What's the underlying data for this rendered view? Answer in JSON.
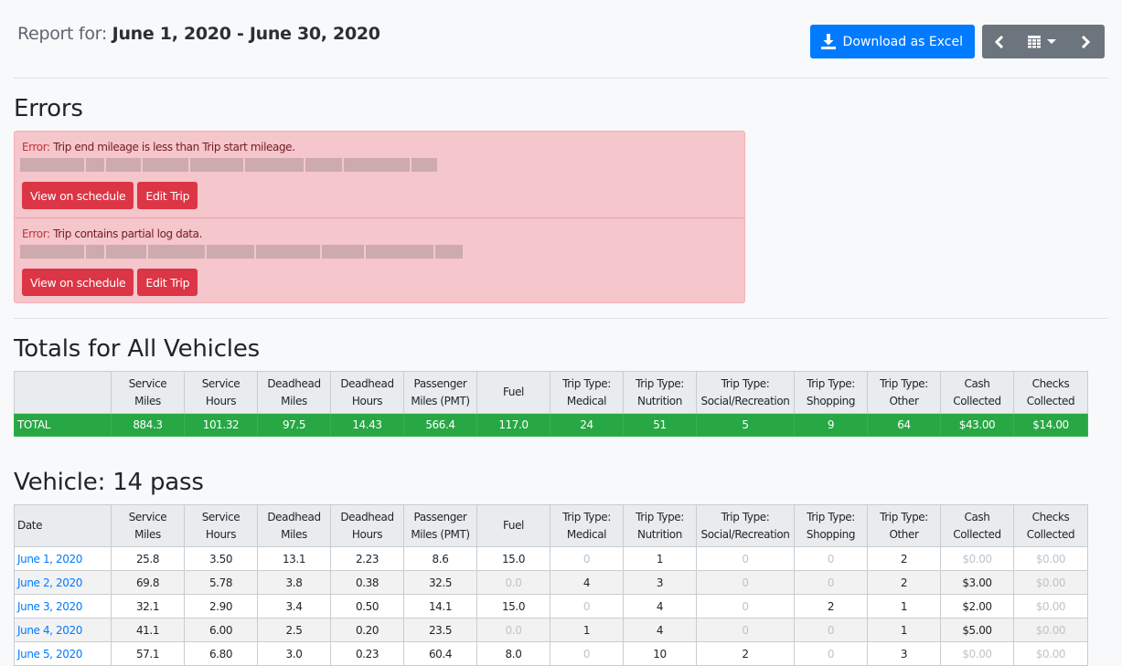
{
  "header": {
    "label": "Report for:",
    "range": "June 1, 2020 - June 30, 2020"
  },
  "actions": {
    "download_label": "Download as Excel",
    "download_icon": "download-icon",
    "prev_icon": "caret-left-icon",
    "calendar_icon": "calendar-icon",
    "next_icon": "caret-right-icon"
  },
  "errors": {
    "title": "Errors",
    "items": [
      {
        "label": "Error:",
        "message": "Trip end mileage is less than Trip start mileage.",
        "view": "View on schedule",
        "edit": "Edit Trip"
      },
      {
        "label": "Error:",
        "message": "Trip contains partial log data.",
        "view": "View on schedule",
        "edit": "Edit Trip"
      }
    ]
  },
  "columns": [
    {
      "l1": "Service",
      "l2": "Miles"
    },
    {
      "l1": "Service",
      "l2": "Hours"
    },
    {
      "l1": "Deadhead",
      "l2": "Miles"
    },
    {
      "l1": "Deadhead",
      "l2": "Hours"
    },
    {
      "l1": "Passenger",
      "l2": "Miles (PMT)"
    },
    {
      "l1": "Fuel",
      "l2": ""
    },
    {
      "l1": "Trip Type:",
      "l2": "Medical"
    },
    {
      "l1": "Trip Type:",
      "l2": "Nutrition"
    },
    {
      "l1": "Trip Type:",
      "l2": "Social/Recreation"
    },
    {
      "l1": "Trip Type:",
      "l2": "Shopping"
    },
    {
      "l1": "Trip Type:",
      "l2": "Other"
    },
    {
      "l1": "Cash",
      "l2": "Collected"
    },
    {
      "l1": "Checks",
      "l2": "Collected"
    }
  ],
  "totals": {
    "title": "Totals for All Vehicles",
    "row_label": "TOTAL",
    "values": [
      "884.3",
      "101.32",
      "97.5",
      "14.43",
      "566.4",
      "117.0",
      "24",
      "51",
      "5",
      "9",
      "64",
      "$43.00",
      "$14.00"
    ]
  },
  "vehicle": {
    "title": "Vehicle: 14 pass",
    "date_header": "Date",
    "rows": [
      {
        "date": "June 1, 2020",
        "values": [
          "25.8",
          "3.50",
          "13.1",
          "2.23",
          "8.6",
          "15.0",
          "0",
          "1",
          "0",
          "0",
          "2",
          "$0.00",
          "$0.00"
        ]
      },
      {
        "date": "June 2, 2020",
        "values": [
          "69.8",
          "5.78",
          "3.8",
          "0.38",
          "32.5",
          "0.0",
          "4",
          "3",
          "0",
          "0",
          "2",
          "$3.00",
          "$0.00"
        ]
      },
      {
        "date": "June 3, 2020",
        "values": [
          "32.1",
          "2.90",
          "3.4",
          "0.50",
          "14.1",
          "15.0",
          "0",
          "4",
          "0",
          "2",
          "1",
          "$2.00",
          "$0.00"
        ]
      },
      {
        "date": "June 4, 2020",
        "values": [
          "41.1",
          "6.00",
          "2.5",
          "0.20",
          "23.5",
          "0.0",
          "1",
          "4",
          "0",
          "0",
          "1",
          "$5.00",
          "$0.00"
        ]
      },
      {
        "date": "June 5, 2020",
        "values": [
          "57.1",
          "6.80",
          "3.0",
          "0.23",
          "60.4",
          "8.0",
          "0",
          "10",
          "2",
          "0",
          "3",
          "$0.00",
          "$0.00"
        ]
      }
    ]
  },
  "colors": {
    "primary": "#007bff",
    "danger": "#dc3545",
    "success": "#28a745",
    "secondary": "#6c757d",
    "error_bg": "#f5c6cb"
  }
}
